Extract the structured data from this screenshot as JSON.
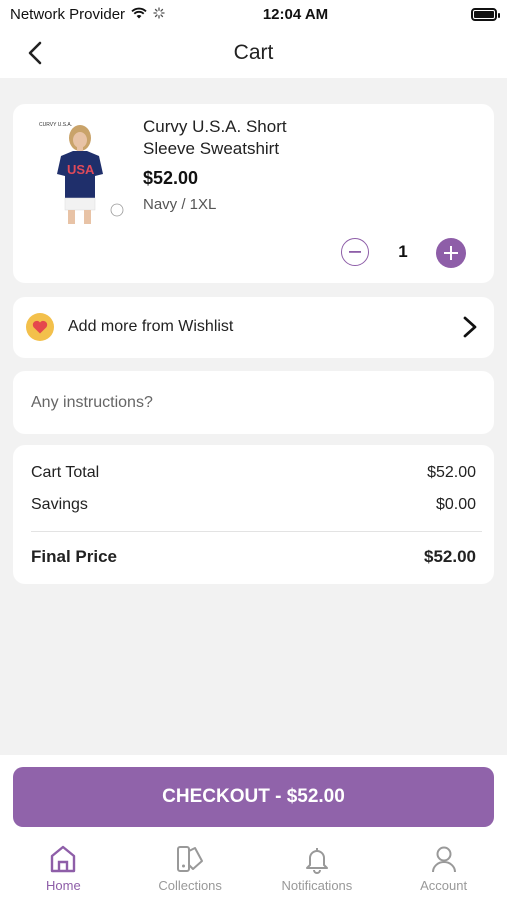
{
  "status_bar": {
    "carrier": "Network Provider",
    "time": "12:04 AM",
    "battery_level": 1.0
  },
  "header": {
    "title": "Cart",
    "back_icon": "chevron-left-icon"
  },
  "cart_item": {
    "image_brand_text": "CURVY U.S.A.",
    "image_shirt_text": "USA",
    "name": "Curvy U.S.A. Short Sleeve Sweatshirt",
    "price": "$52.00",
    "variant": "Navy / 1XL",
    "quantity": "1"
  },
  "wishlist": {
    "label": "Add more from Wishlist",
    "icon": "heart-icon"
  },
  "instructions": {
    "placeholder": "Any instructions?",
    "value": ""
  },
  "summary": {
    "cart_total_label": "Cart Total",
    "cart_total_value": "$52.00",
    "savings_label": "Savings",
    "savings_value": "$0.00",
    "final_price_label": "Final Price",
    "final_price_value": "$52.00"
  },
  "checkout": {
    "label": "CHECKOUT - $52.00"
  },
  "tabbar": {
    "items": [
      {
        "label": "Home",
        "icon": "home-icon",
        "active": true
      },
      {
        "label": "Collections",
        "icon": "collections-icon",
        "active": false
      },
      {
        "label": "Notifications",
        "icon": "bell-icon",
        "active": false
      },
      {
        "label": "Account",
        "icon": "user-icon",
        "active": false
      }
    ]
  },
  "colors": {
    "accent": "#9063aa",
    "background": "#f2f2f2",
    "card": "#ffffff",
    "wishlist_icon_bg": "#f3c04b",
    "heart": "#e5484d",
    "tab_inactive": "#999999"
  }
}
